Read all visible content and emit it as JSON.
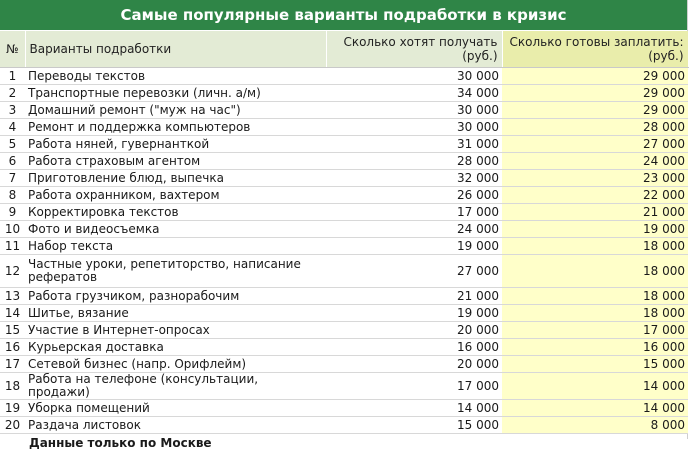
{
  "title": "Самые популярные варианты подработки в кризис",
  "headers": {
    "num": "№",
    "job": "Варианты подработки",
    "want_line1": "Сколько хотят получать",
    "want_line2": "(руб.)",
    "pay_line1": "Сколько готовы заплатить:",
    "pay_line2": "(руб.)"
  },
  "rows": [
    {
      "num": "1",
      "job": "Переводы текстов",
      "want": "30 000",
      "pay": "29 000"
    },
    {
      "num": "2",
      "job": "Транспортные перевозки (личн. а/м)",
      "want": "34 000",
      "pay": "29 000"
    },
    {
      "num": "3",
      "job": "Домашний ремонт (\"муж на час\")",
      "want": "30 000",
      "pay": "29 000"
    },
    {
      "num": "4",
      "job": "Ремонт и поддержка компьютеров",
      "want": "30 000",
      "pay": "28 000"
    },
    {
      "num": "5",
      "job": "Работа няней, гувернанткой",
      "want": "31 000",
      "pay": "27 000"
    },
    {
      "num": "6",
      "job": "Работа страховым агентом",
      "want": "28 000",
      "pay": "24 000"
    },
    {
      "num": "7",
      "job": "Приготовление блюд, выпечка",
      "want": "32 000",
      "pay": "23 000"
    },
    {
      "num": "8",
      "job": "Работа охранником, вахтером",
      "want": "26 000",
      "pay": "22 000"
    },
    {
      "num": "9",
      "job": "Корректировка текстов",
      "want": "17 000",
      "pay": "21 000"
    },
    {
      "num": "10",
      "job": "Фото и видеосъемка",
      "want": "24 000",
      "pay": "19 000"
    },
    {
      "num": "11",
      "job": "Набор текста",
      "want": "19 000",
      "pay": "18 000"
    },
    {
      "num": "12",
      "job": "Частные уроки, репетиторство, написание рефератов",
      "want": "27 000",
      "pay": "18 000"
    },
    {
      "num": "13",
      "job": "Работа грузчиком, разнорабочим",
      "want": "21 000",
      "pay": "18 000"
    },
    {
      "num": "14",
      "job": "Шитье, вязание",
      "want": "19 000",
      "pay": "18 000"
    },
    {
      "num": "15",
      "job": "Участие в Интернет-опросах",
      "want": "20 000",
      "pay": "17 000"
    },
    {
      "num": "16",
      "job": "Курьерская доставка",
      "want": "16 000",
      "pay": "16 000"
    },
    {
      "num": "17",
      "job": "Сетевой бизнес (напр. Орифлейм)",
      "want": "20 000",
      "pay": "15 000"
    },
    {
      "num": "18",
      "job": "Работа на телефоне (консультации, продажи)",
      "want": "17 000",
      "pay": "14 000"
    },
    {
      "num": "19",
      "job": "Уборка помещений",
      "want": "14 000",
      "pay": "14 000"
    },
    {
      "num": "20",
      "job": "Раздача листовок",
      "want": "15 000",
      "pay": "8 000"
    }
  ],
  "footer": "Данные только по Москве",
  "colors": {
    "title_bg": "#2f8547",
    "header_bg": "#e3ebd5",
    "pay_header_bg": "#e9edab",
    "pay_cell_bg": "#ffffc9"
  }
}
